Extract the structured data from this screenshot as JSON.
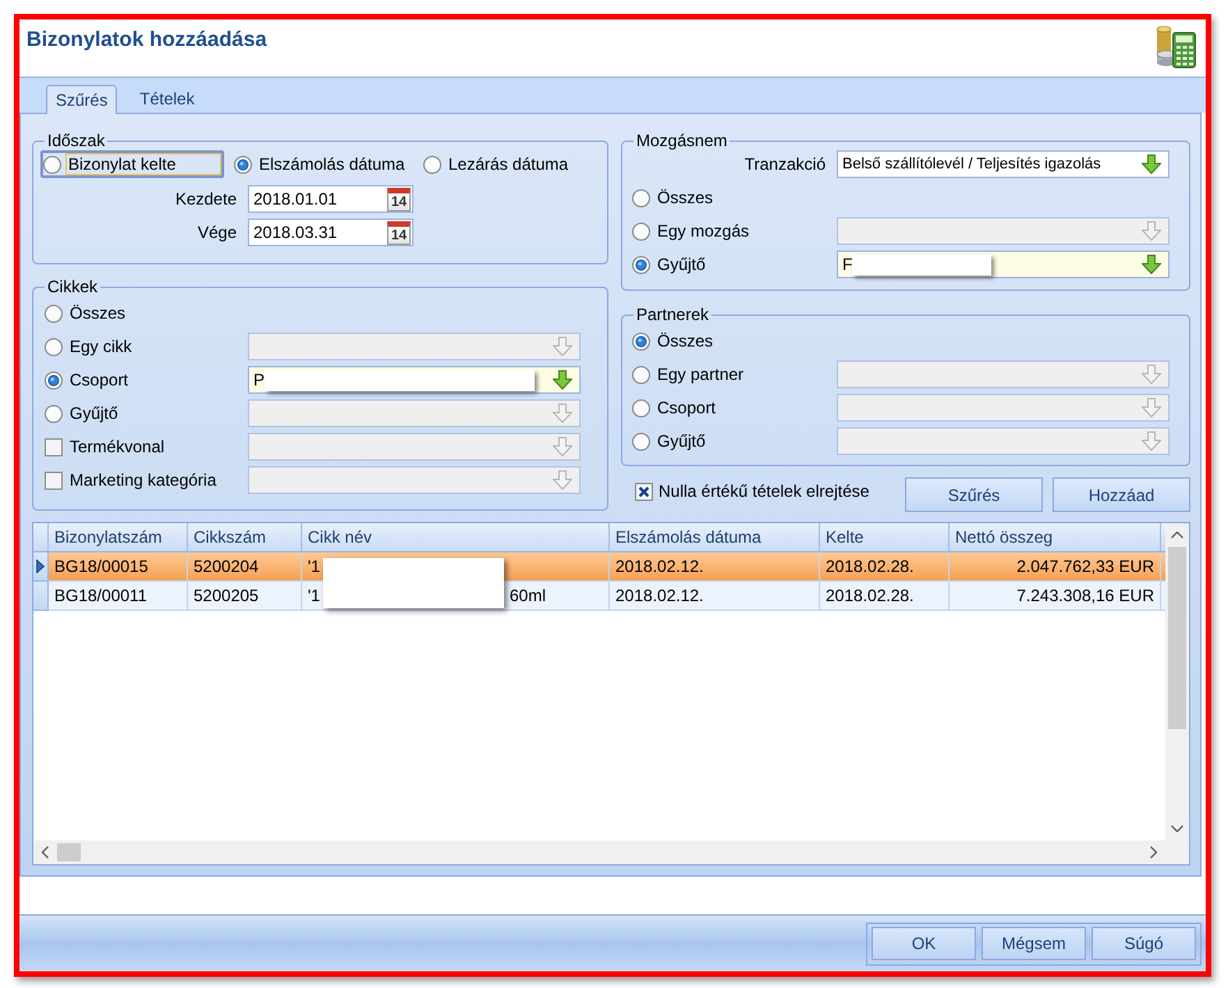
{
  "window": {
    "title": "Bizonylatok hozzáadása"
  },
  "tabs": [
    {
      "label": "Szűrés",
      "selected": true
    },
    {
      "label": "Tételek",
      "selected": false
    }
  ],
  "period": {
    "legend": "Időszak",
    "options": [
      {
        "label": "Bizonylat kelte",
        "selected": false,
        "focused": true
      },
      {
        "label": "Elszámolás dátuma",
        "selected": true,
        "focused": false
      },
      {
        "label": "Lezárás dátuma",
        "selected": false,
        "focused": false
      }
    ],
    "dates": [
      {
        "label": "Kezdete",
        "value": "2018.01.01",
        "calendar_day": "14"
      },
      {
        "label": "Vége",
        "value": "2018.03.31",
        "calendar_day": "14"
      }
    ]
  },
  "items": {
    "legend": "Cikkek",
    "rows": [
      {
        "kind": "radio",
        "label": "Összes",
        "selected": false
      },
      {
        "kind": "radio",
        "label": "Egy cikk",
        "selected": false,
        "field": {
          "disabled": true,
          "highlighted": false
        }
      },
      {
        "kind": "radio",
        "label": "Csoport",
        "selected": true,
        "field": {
          "disabled": false,
          "highlighted": true,
          "value": "P",
          "redacted": true
        }
      },
      {
        "kind": "radio",
        "label": "Gyűjtő",
        "selected": false,
        "field": {
          "disabled": true,
          "highlighted": false
        }
      },
      {
        "kind": "checkbox",
        "label": "Termékvonal",
        "checked": false,
        "field": {
          "disabled": true,
          "highlighted": false
        }
      },
      {
        "kind": "checkbox",
        "label": "Marketing kategória",
        "checked": false,
        "field": {
          "disabled": true,
          "highlighted": false
        }
      }
    ]
  },
  "movement": {
    "legend": "Mozgásnem",
    "transaction": {
      "label": "Tranzakció",
      "field": {
        "disabled": false,
        "highlighted": false,
        "value": "Belső szállítólevél / Teljesítés igazolás"
      }
    },
    "rows": [
      {
        "kind": "radio",
        "label": "Összes",
        "selected": false
      },
      {
        "kind": "radio",
        "label": "Egy mozgás",
        "selected": false,
        "field": {
          "disabled": true,
          "highlighted": false
        }
      },
      {
        "kind": "radio",
        "label": "Gyűjtő",
        "selected": true,
        "field": {
          "disabled": false,
          "highlighted": true,
          "value": "F",
          "redacted": true
        }
      }
    ]
  },
  "partners": {
    "legend": "Partnerek",
    "rows": [
      {
        "kind": "radio",
        "label": "Összes",
        "selected": true
      },
      {
        "kind": "radio",
        "label": "Egy partner",
        "selected": false,
        "field": {
          "disabled": true,
          "highlighted": false
        }
      },
      {
        "kind": "radio",
        "label": "Csoport",
        "selected": false,
        "field": {
          "disabled": true,
          "highlighted": false
        }
      },
      {
        "kind": "radio",
        "label": "Gyűjtő",
        "selected": false,
        "field": {
          "disabled": true,
          "highlighted": false
        }
      }
    ]
  },
  "hide_zero": {
    "label": "Nulla értékű tételek elrejtése",
    "checked": true
  },
  "filter_buttons": [
    "Szűrés",
    "Hozzáad"
  ],
  "table": {
    "columns": [
      "Bizonylatszám",
      "Cikkszám",
      "Cikk név",
      "Elszámolás dátuma",
      "Kelte",
      "Nettó összeg"
    ],
    "redacted": true,
    "rows": [
      {
        "selected": true,
        "current": true,
        "cells": [
          "BG18/00015",
          "5200204",
          [
            "'1"
          ],
          "2018.02.12.",
          "2018.02.28.",
          "2.047.762,33 EUR"
        ]
      },
      {
        "selected": false,
        "current": false,
        "cells": [
          "BG18/00011",
          "5200205",
          [
            "'1",
            "60ml"
          ],
          "2018.02.12.",
          "2018.02.28.",
          "7.243.308,16 EUR"
        ]
      }
    ]
  },
  "buttons": [
    "OK",
    "Mégsem",
    "Súgó"
  ]
}
